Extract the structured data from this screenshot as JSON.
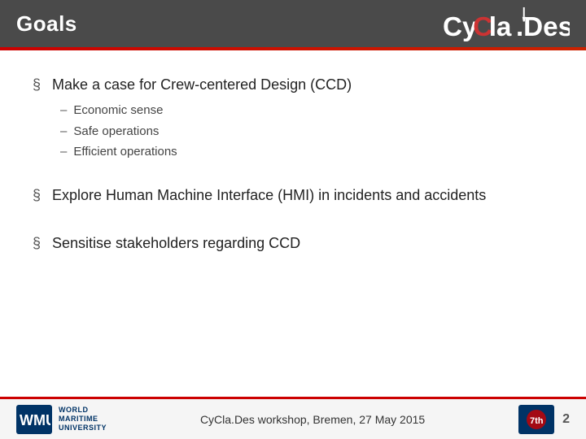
{
  "header": {
    "title": "Goals",
    "logo": "CyClaDes"
  },
  "bullets": [
    {
      "id": "bullet-1",
      "text": "Make a case for Crew-centered Design (CCD)",
      "sub_items": [
        "Economic sense",
        "Safe operations",
        "Efficient operations"
      ]
    },
    {
      "id": "bullet-2",
      "text": "Explore Human Machine Interface (HMI) in incidents and accidents",
      "sub_items": []
    },
    {
      "id": "bullet-3",
      "text": "Sensitise stakeholders regarding CCD",
      "sub_items": []
    }
  ],
  "footer": {
    "wmu_line1": "WORLD",
    "wmu_line2": "MARITIME",
    "wmu_line3": "UNIVERSITY",
    "workshop_text": "CyCla.Des workshop, Bremen, 27 May 2015",
    "page_number": "2"
  }
}
